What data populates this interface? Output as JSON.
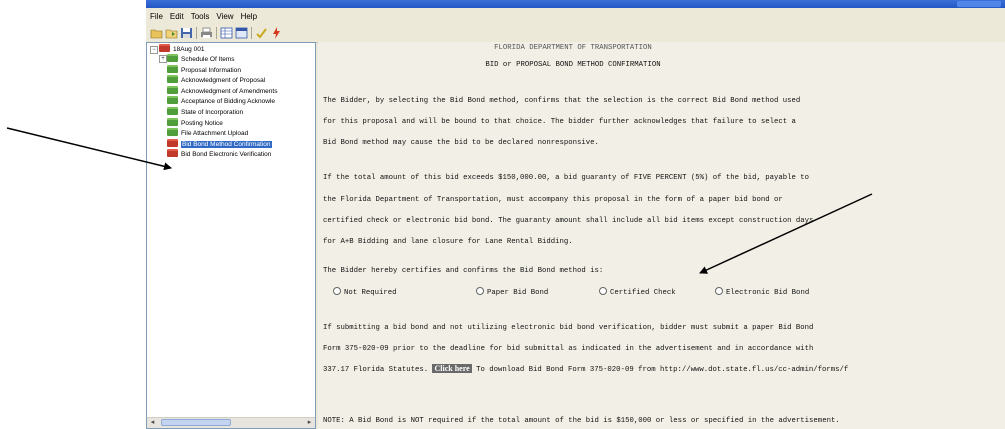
{
  "menu": [
    "File",
    "Edit",
    "Tools",
    "View",
    "Help"
  ],
  "toolbar_icons": [
    "open-folder-icon",
    "folder-icon",
    "save-icon",
    "print-icon",
    "grid-icon",
    "list-icon",
    "check-icon",
    "lightning-icon"
  ],
  "tree": {
    "root": "18Aug 001",
    "items": [
      {
        "label": "Schedule Of Items",
        "color": "green",
        "expandable": true
      },
      {
        "label": "Proposal Information",
        "color": "green"
      },
      {
        "label": "Acknowledgment of Proposal",
        "color": "green"
      },
      {
        "label": "Acknowledgment of Amendments",
        "color": "green"
      },
      {
        "label": "Acceptance of Bidding Acknowle",
        "color": "green"
      },
      {
        "label": "State of Incorporation",
        "color": "green"
      },
      {
        "label": "Posting Notice",
        "color": "green"
      },
      {
        "label": "File Attachment Upload",
        "color": "green"
      },
      {
        "label": "Bid Bond Method Confirmation",
        "color": "red",
        "selected": true
      },
      {
        "label": "Bid Bond Electronic Verification",
        "color": "red"
      }
    ]
  },
  "doc": {
    "header": "FLORIDA DEPARTMENT OF TRANSPORTATION",
    "title": "BID or PROPOSAL BOND METHOD CONFIRMATION",
    "p1": [
      "The Bidder, by selecting the Bid Bond method, confirms that the selection is the correct Bid Bond method used",
      "for this proposal and will be bound to that choice. The bidder further acknowledges that failure to select a",
      "Bid Bond method may cause the bid to be declared nonresponsive."
    ],
    "p2": [
      "If the total amount of this bid exceeds $150,000.00, a bid guaranty of FIVE PERCENT (5%) of the bid, payable to",
      "the Florida Department of Transportation, must accompany this proposal in the form of a paper bid bond or",
      "certified check or electronic bid bond. The guaranty amount shall include all bid items except construction days",
      "for A+B Bidding and lane closure for Lane Rental Bidding."
    ],
    "certify": "The Bidder hereby certifies and confirms the Bid Bond method is:",
    "options": [
      "Not Required",
      "Paper Bid Bond",
      "Certified Check",
      "Electronic Bid Bond"
    ],
    "p3": [
      "If submitting a bid bond and not utilizing electronic bid bond verification, bidder must submit a paper Bid Bond",
      "Form 375-020-09 prior to the deadline for bid submittal as indicated in the advertisement and in accordance with"
    ],
    "p3_last_prefix": "337.17 Florida Statutes.",
    "click_here": "Click here",
    "p3_last_suffix": "To download Bid Bond Form 375-020-09 from http://www.dot.state.fl.us/cc-admin/forms/f",
    "note": "NOTE: A Bid Bond is NOT required if the total amount of the bid is $150,000 or less or specified in the advertisement."
  }
}
